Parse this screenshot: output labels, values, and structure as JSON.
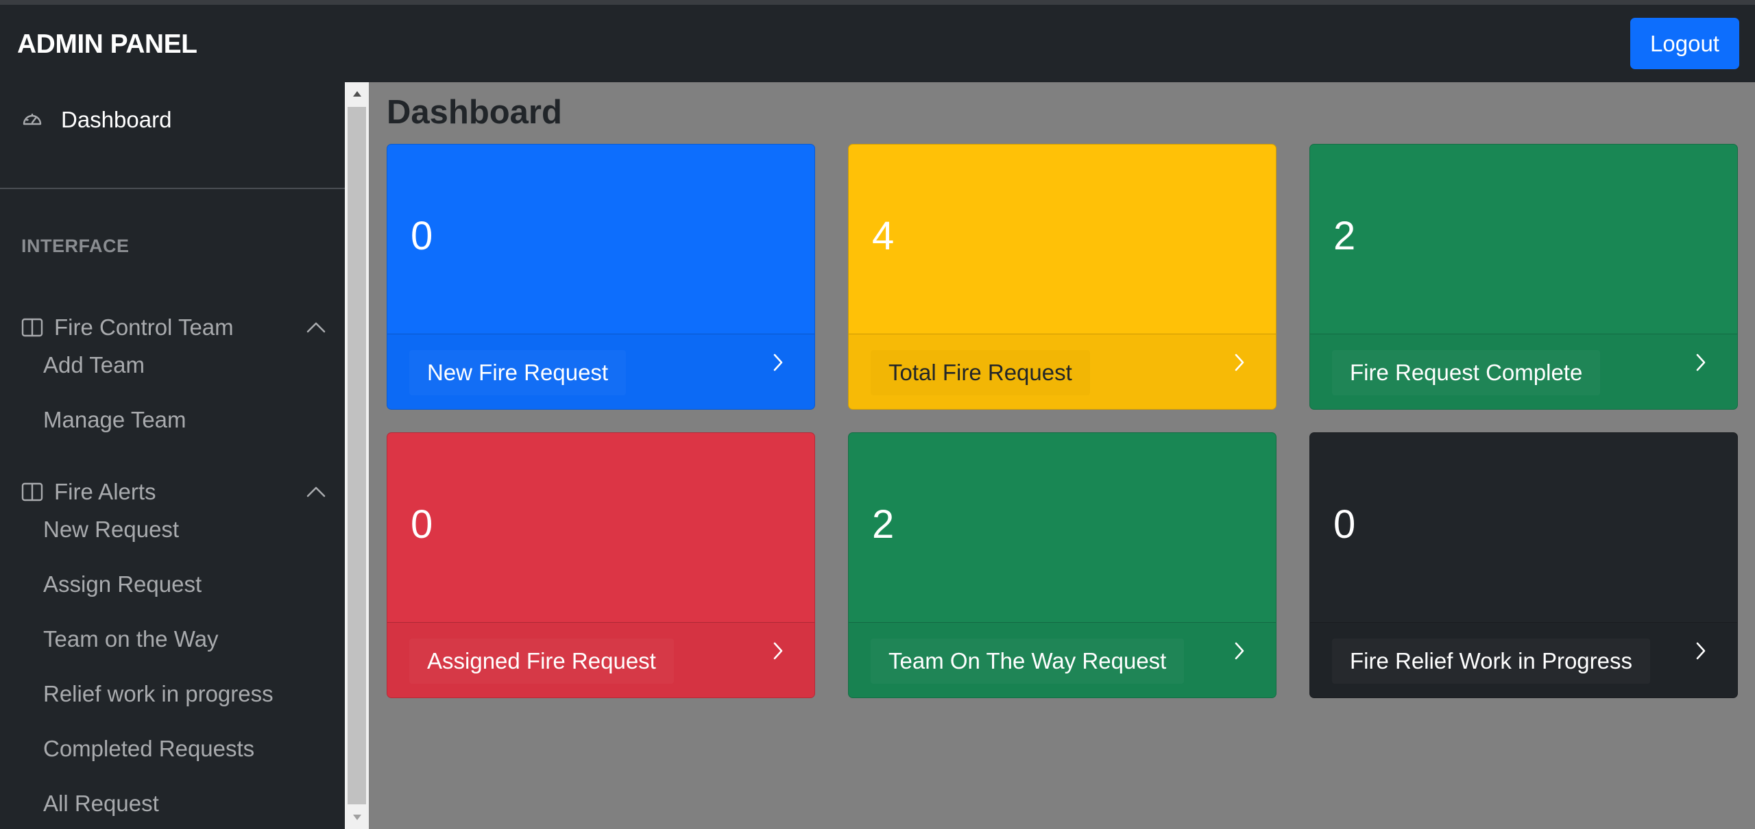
{
  "brand": "ADMIN PANEL",
  "logout_label": "Logout",
  "sidebar": {
    "dashboard_label": "Dashboard",
    "section_heading": "INTERFACE",
    "groups": [
      {
        "label": "Fire Control Team",
        "icon": "columns-icon",
        "expanded": true,
        "items": [
          "Add Team",
          "Manage Team"
        ]
      },
      {
        "label": "Fire Alerts",
        "icon": "columns-icon",
        "expanded": true,
        "items": [
          "New Request",
          "Assign Request",
          "Team on the Way",
          "Relief work in progress",
          "Completed Requests",
          "All Request"
        ]
      }
    ]
  },
  "page_title": "Dashboard",
  "cards": [
    {
      "value": "0",
      "label": "New Fire Request",
      "color": "#0d6efd"
    },
    {
      "value": "4",
      "label": "Total Fire Request",
      "color": "#ffc107"
    },
    {
      "value": "2",
      "label": "Fire Request Complete",
      "color": "#198754"
    },
    {
      "value": "0",
      "label": "Assigned Fire Request",
      "color": "#dc3545"
    },
    {
      "value": "2",
      "label": "Team On The Way Request",
      "color": "#198754"
    },
    {
      "value": "0",
      "label": "Fire Relief Work in Progress",
      "color": "#212529"
    }
  ]
}
